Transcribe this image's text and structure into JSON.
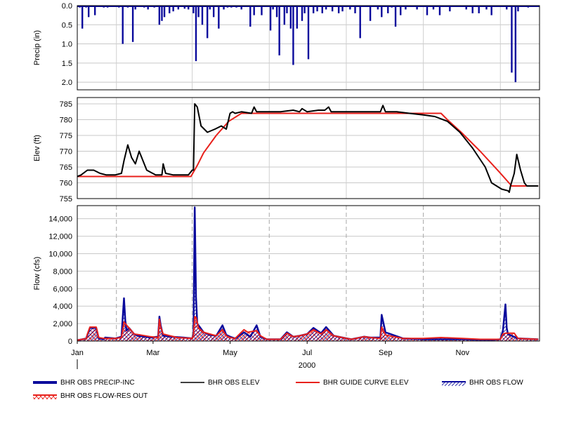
{
  "chart_data": [
    {
      "type": "bar",
      "panel": "precip",
      "ylabel": "Precip (in)",
      "ylim": [
        0,
        2.2
      ],
      "y_inverted": true,
      "yticks": [
        "0.0",
        "0.5",
        "1.0",
        "1.5",
        "2.0"
      ],
      "grid": true,
      "series": [
        {
          "name": "BHR OBS PRECIP-INC",
          "color": "#0a0a9c",
          "x": [
            "2000-01-03",
            "2000-01-05",
            "2000-01-08",
            "2000-01-10",
            "2000-01-15",
            "2000-01-22",
            "2000-01-25",
            "2000-02-03",
            "2000-02-06",
            "2000-02-10",
            "2000-02-14",
            "2000-02-16",
            "2000-02-23",
            "2000-02-26",
            "2000-03-02",
            "2000-03-06",
            "2000-03-08",
            "2000-03-10",
            "2000-03-14",
            "2000-03-17",
            "2000-03-21",
            "2000-03-26",
            "2000-03-29",
            "2000-04-02",
            "2000-04-04",
            "2000-04-06",
            "2000-04-09",
            "2000-04-13",
            "2000-04-15",
            "2000-04-18",
            "2000-04-22",
            "2000-04-26",
            "2000-04-29",
            "2000-05-02",
            "2000-05-06",
            "2000-05-10",
            "2000-05-17",
            "2000-05-20",
            "2000-05-26",
            "2000-06-02",
            "2000-06-04",
            "2000-06-07",
            "2000-06-09",
            "2000-06-13",
            "2000-06-15",
            "2000-06-18",
            "2000-06-20",
            "2000-06-23",
            "2000-06-27",
            "2000-06-29",
            "2000-07-02",
            "2000-07-06",
            "2000-07-09",
            "2000-07-13",
            "2000-07-16",
            "2000-07-21",
            "2000-07-26",
            "2000-07-29",
            "2000-08-04",
            "2000-08-08",
            "2000-08-12",
            "2000-08-20",
            "2000-08-26",
            "2000-08-29",
            "2000-09-03",
            "2000-09-06",
            "2000-09-09",
            "2000-09-13",
            "2000-09-17",
            "2000-09-26",
            "2000-10-04",
            "2000-10-09",
            "2000-10-14",
            "2000-10-22",
            "2000-11-04",
            "2000-11-09",
            "2000-11-14",
            "2000-11-20",
            "2000-11-24",
            "2000-12-06",
            "2000-12-10",
            "2000-12-13",
            "2000-12-15",
            "2000-12-23"
          ],
          "values": [
            0.05,
            0.6,
            0.05,
            0.3,
            0.25,
            0.05,
            0.05,
            0.05,
            1.0,
            0.05,
            0.95,
            0.1,
            0.05,
            0.1,
            0.05,
            0.5,
            0.4,
            0.3,
            0.2,
            0.15,
            0.1,
            0.08,
            0.1,
            0.2,
            1.45,
            0.3,
            0.5,
            0.85,
            0.1,
            0.3,
            0.6,
            0.1,
            0.05,
            0.05,
            0.05,
            0.1,
            0.55,
            0.25,
            0.25,
            0.65,
            0.1,
            0.3,
            1.3,
            0.5,
            0.2,
            0.6,
            1.55,
            0.6,
            0.4,
            0.2,
            1.4,
            0.2,
            0.15,
            0.2,
            0.1,
            0.15,
            0.2,
            0.15,
            0.1,
            0.2,
            0.85,
            0.4,
            0.1,
            0.3,
            0.2,
            0.05,
            0.55,
            0.25,
            0.1,
            0.1,
            0.25,
            0.1,
            0.25,
            0.15,
            0.1,
            0.2,
            0.2,
            0.1,
            0.25,
            0.1,
            1.75,
            2.0,
            0.15,
            0.05
          ]
        }
      ]
    },
    {
      "type": "line",
      "panel": "elev",
      "ylabel": "Elev (ft)",
      "ylim": [
        755,
        787
      ],
      "yticks": [
        "755",
        "760",
        "765",
        "770",
        "775",
        "780",
        "785"
      ],
      "grid": true,
      "series": [
        {
          "name": "BHR OBS ELEV",
          "color": "#000000",
          "x": [
            "2000-01-01",
            "2000-01-04",
            "2000-01-09",
            "2000-01-14",
            "2000-01-19",
            "2000-01-24",
            "2000-01-31",
            "2000-02-05",
            "2000-02-07",
            "2000-02-10",
            "2000-02-13",
            "2000-02-16",
            "2000-02-19",
            "2000-02-25",
            "2000-03-03",
            "2000-03-08",
            "2000-03-09",
            "2000-03-11",
            "2000-03-17",
            "2000-03-20",
            "2000-03-29",
            "2000-04-01",
            "2000-04-02",
            "2000-04-03",
            "2000-04-05",
            "2000-04-08",
            "2000-04-13",
            "2000-04-19",
            "2000-04-24",
            "2000-04-28",
            "2000-05-01",
            "2000-05-03",
            "2000-05-05",
            "2000-05-10",
            "2000-05-18",
            "2000-05-20",
            "2000-05-22",
            "2000-06-01",
            "2000-06-10",
            "2000-06-20",
            "2000-06-25",
            "2000-06-27",
            "2000-07-01",
            "2000-07-10",
            "2000-07-15",
            "2000-07-18",
            "2000-07-20",
            "2000-08-01",
            "2000-08-15",
            "2000-08-28",
            "2000-08-30",
            "2000-09-01",
            "2000-09-10",
            "2000-09-20",
            "2000-10-01",
            "2000-10-10",
            "2000-10-20",
            "2000-10-30",
            "2000-11-09",
            "2000-11-19",
            "2000-11-24",
            "2000-12-02",
            "2000-12-07",
            "2000-12-08",
            "2000-12-09",
            "2000-12-12",
            "2000-12-14",
            "2000-12-17",
            "2000-12-20",
            "2000-12-22",
            "2000-12-31"
          ],
          "values": [
            762,
            762.5,
            764,
            764,
            763,
            762.5,
            762.5,
            763,
            767,
            772,
            768,
            766,
            770,
            764,
            762.5,
            762.5,
            766,
            763,
            762.5,
            762.5,
            762.5,
            764,
            764,
            785,
            784,
            778,
            776,
            777,
            778,
            777,
            782,
            782.5,
            782,
            782.5,
            782,
            784,
            782.5,
            782.5,
            782.5,
            783,
            782.5,
            783.5,
            782.5,
            783,
            783,
            784,
            782.5,
            782.5,
            782.5,
            782.5,
            784.5,
            782.5,
            782.5,
            782,
            781.5,
            781,
            779.5,
            776,
            771,
            765,
            760,
            758,
            757.5,
            757,
            759,
            763,
            769,
            764,
            760,
            759,
            759
          ]
        },
        {
          "name": "BHR GUIDE CURVE ELEV",
          "color": "#e8211c",
          "x": [
            "2000-01-01",
            "2000-03-31",
            "2000-04-05",
            "2000-04-10",
            "2000-04-20",
            "2000-04-30",
            "2000-05-10",
            "2000-05-15",
            "2000-10-15",
            "2000-10-20",
            "2000-10-31",
            "2000-11-15",
            "2000-11-30",
            "2000-12-10",
            "2000-12-31"
          ],
          "values": [
            762,
            762,
            765.5,
            769.5,
            775,
            779.5,
            782,
            782,
            782,
            780,
            776,
            770,
            763.5,
            759,
            759
          ]
        }
      ]
    },
    {
      "type": "area",
      "panel": "flow",
      "ylabel": "Flow (cfs)",
      "ylim": [
        0,
        15500
      ],
      "yticks": [
        "0",
        "2,000",
        "4,000",
        "6,000",
        "8,000",
        "10,000",
        "12,000",
        "14,000"
      ],
      "xticks": [
        "Jan",
        "Mar",
        "May",
        "Jul",
        "Sep",
        "Nov"
      ],
      "xlabel": "2000",
      "grid": true,
      "series": [
        {
          "name": "BHR OBS FLOW",
          "color": "#0a0a9c",
          "x": [
            "2000-01-01",
            "2000-01-05",
            "2000-01-08",
            "2000-01-09",
            "2000-01-11",
            "2000-01-14",
            "2000-01-16",
            "2000-01-18",
            "2000-01-22",
            "2000-01-23",
            "2000-01-31",
            "2000-02-05",
            "2000-02-07",
            "2000-02-08",
            "2000-02-09",
            "2000-02-11",
            "2000-02-15",
            "2000-02-18",
            "2000-02-23",
            "2000-02-28",
            "2000-03-05",
            "2000-03-06",
            "2000-03-07",
            "2000-03-09",
            "2000-03-15",
            "2000-03-25",
            "2000-04-01",
            "2000-04-02",
            "2000-04-03",
            "2000-04-04",
            "2000-04-05",
            "2000-04-10",
            "2000-04-15",
            "2000-04-20",
            "2000-04-25",
            "2000-04-28",
            "2000-05-01",
            "2000-05-05",
            "2000-05-12",
            "2000-05-17",
            "2000-05-22",
            "2000-05-25",
            "2000-05-30",
            "2000-06-10",
            "2000-06-15",
            "2000-06-20",
            "2000-06-25",
            "2000-07-01",
            "2000-07-06",
            "2000-07-12",
            "2000-07-16",
            "2000-07-22",
            "2000-08-05",
            "2000-08-15",
            "2000-08-20",
            "2000-08-28",
            "2000-08-29",
            "2000-09-01",
            "2000-09-15",
            "2000-10-01",
            "2000-10-15",
            "2000-11-01",
            "2000-11-15",
            "2000-11-25",
            "2000-12-01",
            "2000-12-03",
            "2000-12-05",
            "2000-12-06",
            "2000-12-07",
            "2000-12-10",
            "2000-12-15",
            "2000-12-31"
          ],
          "values": [
            100,
            200,
            300,
            700,
            1500,
            1500,
            1500,
            300,
            200,
            400,
            300,
            500,
            4900,
            2400,
            1200,
            1500,
            800,
            600,
            500,
            400,
            500,
            2800,
            1800,
            600,
            500,
            400,
            300,
            800,
            15300,
            5000,
            2000,
            1000,
            700,
            600,
            1800,
            700,
            500,
            300,
            1000,
            500,
            1800,
            500,
            200,
            200,
            1000,
            500,
            600,
            800,
            1500,
            900,
            1600,
            600,
            200,
            500,
            400,
            400,
            3000,
            1000,
            300,
            200,
            200,
            200,
            150,
            150,
            200,
            1200,
            4200,
            1500,
            800,
            600,
            300,
            200
          ]
        },
        {
          "name": "BHR OBS FLOW-RES OUT",
          "color": "#e8211c",
          "x": [
            "2000-01-01",
            "2000-01-05",
            "2000-01-08",
            "2000-01-09",
            "2000-01-11",
            "2000-01-14",
            "2000-01-16",
            "2000-01-18",
            "2000-01-22",
            "2000-01-25",
            "2000-01-31",
            "2000-02-05",
            "2000-02-07",
            "2000-02-08",
            "2000-02-11",
            "2000-02-15",
            "2000-02-20",
            "2000-02-28",
            "2000-03-05",
            "2000-03-06",
            "2000-03-07",
            "2000-03-09",
            "2000-03-20",
            "2000-04-01",
            "2000-04-02",
            "2000-04-03",
            "2000-04-04",
            "2000-04-06",
            "2000-04-10",
            "2000-04-15",
            "2000-04-20",
            "2000-04-25",
            "2000-04-28",
            "2000-05-01",
            "2000-05-05",
            "2000-05-12",
            "2000-05-15",
            "2000-05-22",
            "2000-05-25",
            "2000-05-30",
            "2000-06-10",
            "2000-06-15",
            "2000-06-20",
            "2000-06-25",
            "2000-07-01",
            "2000-07-06",
            "2000-07-12",
            "2000-07-16",
            "2000-07-22",
            "2000-08-05",
            "2000-08-15",
            "2000-08-20",
            "2000-08-28",
            "2000-08-29",
            "2000-09-01",
            "2000-09-15",
            "2000-10-01",
            "2000-10-15",
            "2000-11-01",
            "2000-11-15",
            "2000-11-25",
            "2000-12-01",
            "2000-12-03",
            "2000-12-05",
            "2000-12-08",
            "2000-12-12",
            "2000-12-15",
            "2000-12-31"
          ],
          "values": [
            100,
            200,
            300,
            800,
            1600,
            1600,
            1600,
            400,
            300,
            300,
            300,
            400,
            2200,
            2000,
            1500,
            800,
            700,
            500,
            400,
            2500,
            1600,
            800,
            400,
            300,
            700,
            2800,
            2700,
            1500,
            1000,
            800,
            600,
            1300,
            600,
            400,
            300,
            1300,
            1000,
            1200,
            600,
            200,
            200,
            900,
            500,
            600,
            800,
            1300,
            800,
            1300,
            600,
            200,
            500,
            400,
            300,
            1600,
            700,
            300,
            300,
            400,
            300,
            200,
            200,
            200,
            800,
            900,
            900,
            900,
            300,
            200
          ]
        }
      ]
    }
  ],
  "legend": [
    {
      "label": "BHR OBS PRECIP-INC",
      "icon": "thick-blue-line"
    },
    {
      "label": "BHR OBS ELEV",
      "icon": "black-line"
    },
    {
      "label": "BHR GUIDE CURVE ELEV",
      "icon": "red-line"
    },
    {
      "label": "BHR OBS FLOW",
      "icon": "blue-hatched-area"
    },
    {
      "label": "BHR OBS FLOW-RES OUT",
      "icon": "red-hatched-area"
    }
  ]
}
